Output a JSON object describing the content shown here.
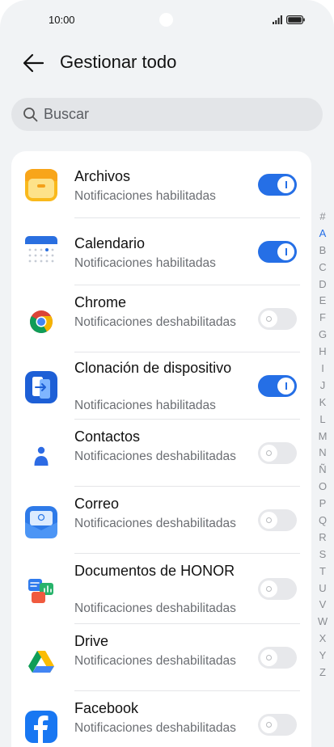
{
  "status_bar": {
    "time": "10:00"
  },
  "header": {
    "title": "Gestionar todo"
  },
  "search": {
    "placeholder": "Buscar"
  },
  "apps": [
    {
      "name": "Archivos",
      "status": "Notificaciones habilitadas",
      "enabled": true,
      "icon": "files-icon"
    },
    {
      "name": "Calendario",
      "status": "Notificaciones habilitadas",
      "enabled": true,
      "icon": "calendar-icon"
    },
    {
      "name": "Chrome",
      "status": "Notificaciones deshabilitadas",
      "enabled": false,
      "icon": "chrome-icon"
    },
    {
      "name": "Clonación de dispositivo",
      "status": "Notificaciones habilitadas",
      "enabled": true,
      "icon": "device-clone-icon"
    },
    {
      "name": "Contactos",
      "status": "Notificaciones deshabilitadas",
      "enabled": false,
      "icon": "contacts-icon"
    },
    {
      "name": "Correo",
      "status": "Notificaciones deshabilitadas",
      "enabled": false,
      "icon": "mail-icon"
    },
    {
      "name": "Documentos de HONOR",
      "status": "Notificaciones deshabilitadas",
      "enabled": false,
      "icon": "honor-docs-icon"
    },
    {
      "name": "Drive",
      "status": "Notificaciones deshabilitadas",
      "enabled": false,
      "icon": "drive-icon"
    },
    {
      "name": "Facebook",
      "status": "Notificaciones deshabilitadas",
      "enabled": false,
      "icon": "facebook-icon"
    }
  ],
  "alphabet_index": [
    "#",
    "A",
    "B",
    "C",
    "D",
    "E",
    "F",
    "G",
    "H",
    "I",
    "J",
    "K",
    "L",
    "M",
    "N",
    "Ñ",
    "O",
    "P",
    "Q",
    "R",
    "S",
    "T",
    "U",
    "V",
    "W",
    "X",
    "Y",
    "Z"
  ],
  "alphabet_active": "A",
  "colors": {
    "accent": "#256fe6",
    "toggle_off": "#e7e8eb",
    "background": "#f1f3f5"
  }
}
